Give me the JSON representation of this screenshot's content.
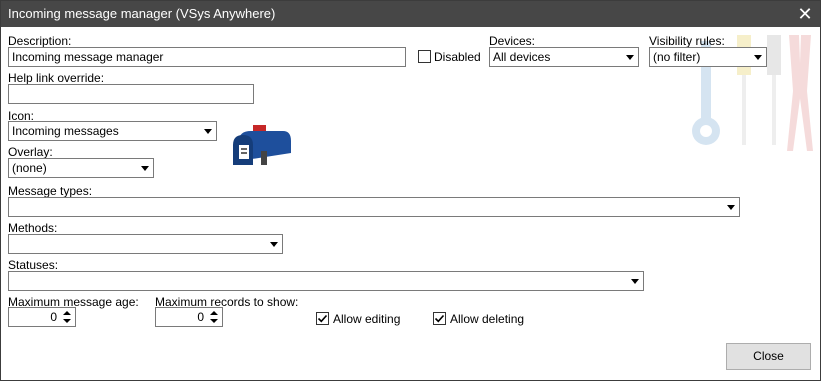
{
  "window": {
    "title": "Incoming message manager (VSys Anywhere)",
    "close_icon": "close-icon"
  },
  "description": {
    "label": "Description:",
    "value": "Incoming message manager"
  },
  "disabled": {
    "label": "Disabled",
    "checked": false
  },
  "devices": {
    "label": "Devices:",
    "value": "All devices"
  },
  "visibility": {
    "label": "Visibility rules:",
    "value": "(no filter)"
  },
  "help_link": {
    "label": "Help link override:",
    "value": ""
  },
  "icon": {
    "label": "Icon:",
    "value": "Incoming messages",
    "preview_icon": "mailbox-icon"
  },
  "overlay": {
    "label": "Overlay:",
    "value": "(none)"
  },
  "message_types": {
    "label": "Message types:",
    "value": ""
  },
  "methods": {
    "label": "Methods:",
    "value": ""
  },
  "statuses": {
    "label": "Statuses:",
    "value": ""
  },
  "max_age": {
    "label": "Maximum message age:",
    "value": "0"
  },
  "max_records": {
    "label": "Maximum records to show:",
    "value": "0"
  },
  "allow_editing": {
    "label": "Allow editing",
    "checked": true
  },
  "allow_deleting": {
    "label": "Allow deleting",
    "checked": true
  },
  "close_button": {
    "label": "Close"
  },
  "decoration": {
    "tools_icon": "tools-icon"
  }
}
